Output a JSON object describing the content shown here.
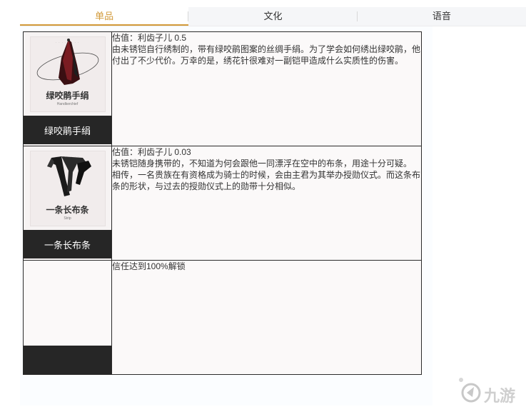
{
  "tabs": [
    {
      "label": "单品",
      "active": true
    },
    {
      "label": "文化",
      "active": false
    },
    {
      "label": "语音",
      "active": false
    }
  ],
  "items": [
    {
      "name": "绿咬鹃手绢",
      "image_caption": "绿咬鹃手绢",
      "image_caption_en": "Handkerchief",
      "value": "估值：利齿子儿 0.5",
      "description": [
        "由未锈铠自行绣制的，带有绿咬鹃图案的丝绸手绢。为了学会如何绣出绿咬鹃，他付出了不少代价。万幸的是，绣花针很难对一副铠甲造成什么实质性的伤害。"
      ]
    },
    {
      "name": "一条长布条",
      "image_caption": "一条长布条",
      "image_caption_en": "Strip",
      "value": "估值：利齿子儿 0.03",
      "description": [
        "未锈铠随身携带的，不知道为何会跟他一同漂浮在空中的布条，用途十分可疑。",
        "相传，一名贵族在有资格成为骑士的时候，会由主君为其举办授勋仪式。而这条布条的形状，与过去的授勋仪式上的勋带十分相似。"
      ]
    },
    {
      "name": "",
      "value": "",
      "description": [
        "信任达到100%解锁"
      ]
    }
  ],
  "colors": {
    "accent": "#d29a3a",
    "name_bar": "#262626",
    "border": "#2b2b2b"
  },
  "watermark": {
    "logo": "jiuyou-logo",
    "text": "九游"
  }
}
